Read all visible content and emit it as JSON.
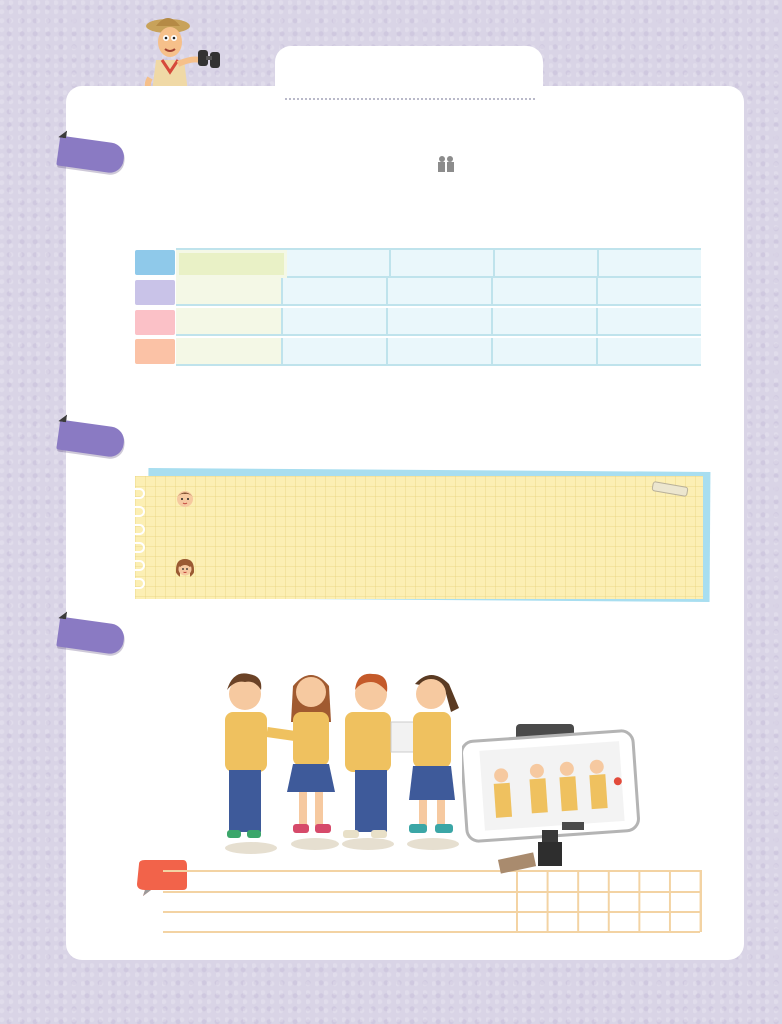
{
  "colors": {
    "background": "#d9d4e6",
    "card": "#ffffff",
    "ribbon": "#8a7ac3",
    "table_row_headers": [
      "#8fc9ea",
      "#c9c3e8",
      "#fbc1c7",
      "#fbc2a6"
    ],
    "note": "#fcefb4",
    "speech_bubble": "#f2634a"
  },
  "icons": {
    "mascot": "explorer-with-binoculars",
    "gift": "gift-icon",
    "boy": "boy-face-icon",
    "girl": "girl-face-icon",
    "camera": "smartphone-on-tripod"
  },
  "table": {
    "rows": 4,
    "columns": 5
  }
}
